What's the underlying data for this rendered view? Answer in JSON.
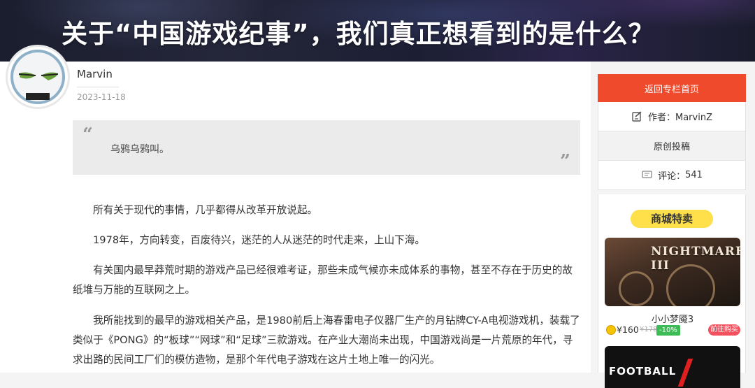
{
  "header": {
    "title": "关于“中国游戏纪事”，我们真正想看到的是什么？"
  },
  "author": {
    "name": "Marvin",
    "date": "2023-11-18"
  },
  "article": {
    "quote": "乌鸦乌鸦叫。",
    "paragraphs": [
      "所有关于现代的事情，几乎都得从改革开放说起。",
      "1978年，方向转变，百废待兴，迷茫的人从迷茫的时代走来，上山下海。",
      "有关国内最早莽荒时期的游戏产品已经很难考证，那些未成气候亦未成体系的事物，甚至不存在于历史的故纸堆与万能的互联网之上。",
      "我所能找到的最早的游戏相关产品，是1980前后上海春雷电子仪器厂生产的月钻牌CY-A电视游戏机，装载了类似于《PONG》的“板球”“网球”和“足球”三款游戏。在产业大潮尚未出现，中国游戏尚是一片荒原的年代，寻求出路的民间工厂们的模仿造物，是那个年代电子游戏在这片土地上唯一的闪光。"
    ]
  },
  "sidebar": {
    "back_label": "返回专栏首页",
    "author_label": "作者：MarvinZ",
    "original_label": "原创投稿",
    "comments_label": "评论：",
    "comments_count": "541"
  },
  "shop": {
    "title": "商城特卖",
    "product": {
      "logo_text": "NIGHTMARES III",
      "name": "小小梦魇3",
      "price": "¥160",
      "original_price": "¥178",
      "discount": "-10%",
      "buy_label": "前往购买"
    },
    "next_product_text": "FOOTBALL"
  },
  "colors": {
    "accent": "#f04a2c",
    "shop_pill": "#ffe04a",
    "discount": "#3dbb55",
    "buy": "#f4505e"
  }
}
